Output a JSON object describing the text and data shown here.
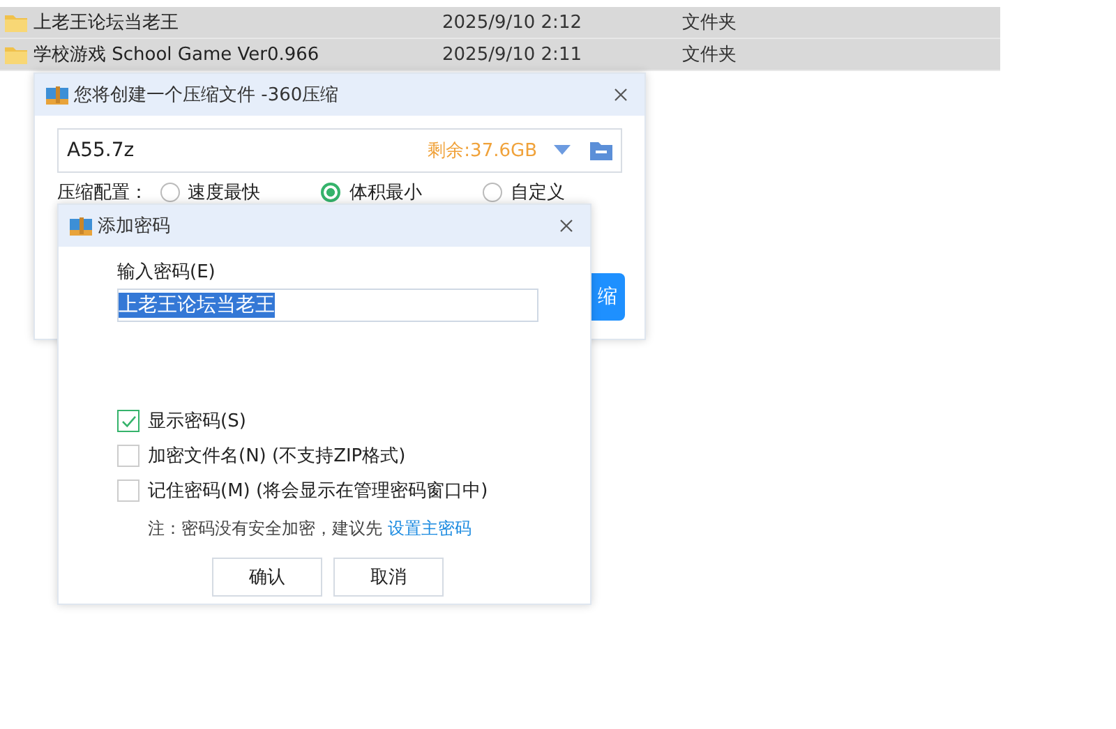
{
  "file_list": {
    "rows": [
      {
        "name": "上老王论坛当老王",
        "date": "2025/9/10 2:12",
        "type": "文件夹"
      },
      {
        "name": "学校游戏 School Game Ver0.966",
        "date": "2025/9/10 2:11",
        "type": "文件夹"
      }
    ]
  },
  "compress_dialog": {
    "title": "您将创建一个压缩文件 -360压缩",
    "filename": "A55.7z",
    "free_space": "剩余:37.6GB",
    "config_label": "压缩配置：",
    "options": [
      {
        "label": "速度最快",
        "selected": false
      },
      {
        "label": "体积最小",
        "selected": true
      },
      {
        "label": "自定义",
        "selected": false
      }
    ],
    "start_button": "缩"
  },
  "password_dialog": {
    "title": "添加密码",
    "field_label": "输入密码(E)",
    "password": "上老王论坛当老王",
    "options": [
      {
        "label": "显示密码(S)",
        "checked": true
      },
      {
        "label": "加密文件名(N) (不支持ZIP格式)",
        "checked": false
      },
      {
        "label": "记住密码(M) (将会显示在管理密码窗口中)",
        "checked": false
      }
    ],
    "note": "注：密码没有安全加密，建议先",
    "note_link": "设置主密码",
    "buttons": [
      "确认",
      "取消"
    ]
  }
}
